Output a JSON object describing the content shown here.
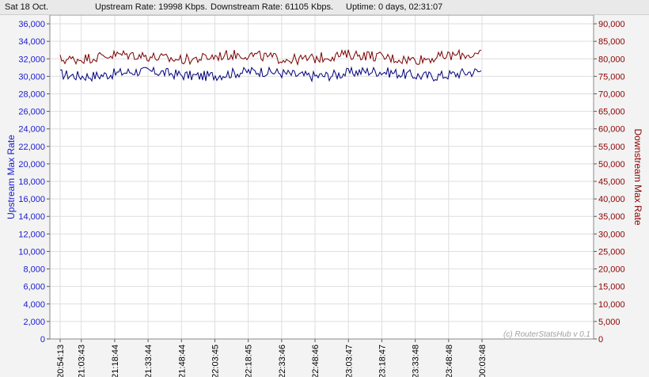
{
  "status": {
    "date": "Sat 18 Oct.",
    "upstream": "Upstream Rate: 19998 Kbps.",
    "downstream": "Downstream Rate: 61105 Kbps.",
    "uptime": "Uptime: 0 days, 02:31:07"
  },
  "chart_data": {
    "type": "line",
    "title": "",
    "watermark": "(c) RouterStatsHub v 0.1",
    "x_tick_labels": [
      "20:54:13",
      "21:03:43",
      "21:18:44",
      "21:33:44",
      "21:48:44",
      "22:03:45",
      "22:18:45",
      "22:33:46",
      "22:48:46",
      "23:03:47",
      "23:18:47",
      "23:33:48",
      "23:48:48",
      "00:03:48"
    ],
    "x_range": [
      "20:54:13",
      "00:03:48"
    ],
    "data_end": "00:03:48",
    "left_axis": {
      "label": "Upstream Max Rate",
      "color": "#1a1ad0",
      "ticks": [
        "0",
        "2,000",
        "4,000",
        "6,000",
        "8,000",
        "10,000",
        "12,000",
        "14,000",
        "16,000",
        "18,000",
        "20,000",
        "22,000",
        "24,000",
        "26,000",
        "28,000",
        "30,000",
        "32,000",
        "34,000",
        "36,000"
      ],
      "range": [
        0,
        37000
      ]
    },
    "right_axis": {
      "label": "Downstream Max Rate",
      "color": "#8b0000",
      "ticks": [
        "0",
        "5,000",
        "10,000",
        "15,000",
        "20,000",
        "25,000",
        "30,000",
        "35,000",
        "40,000",
        "45,000",
        "50,000",
        "55,000",
        "60,000",
        "65,000",
        "70,000",
        "75,000",
        "80,000",
        "85,000",
        "90,000"
      ],
      "range": [
        0,
        92500
      ]
    },
    "grid": true,
    "series": [
      {
        "name": "Upstream Max Rate",
        "axis": "left",
        "color": "#00007a",
        "mean": 30300,
        "min": 28800,
        "max": 31000
      },
      {
        "name": "Downstream Max Rate",
        "axis": "right",
        "color": "#7a0000",
        "mean": 80500,
        "min": 77500,
        "max": 83000
      }
    ]
  }
}
